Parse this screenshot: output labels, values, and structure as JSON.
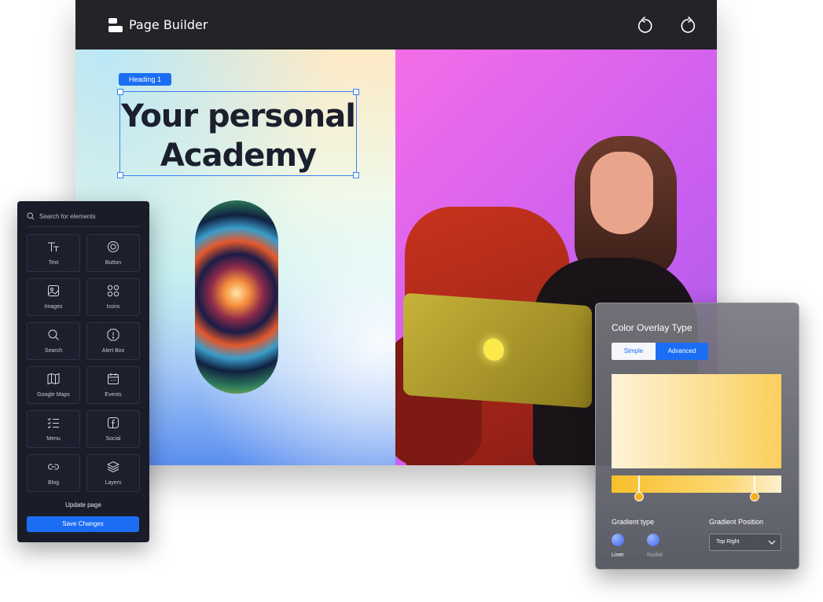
{
  "app": {
    "title": "Page Builder"
  },
  "toolbar": {
    "undo_icon": "undo-icon",
    "redo_icon": "redo-icon"
  },
  "canvas": {
    "heading_tag": "Heading 1",
    "heading_line1": "Your personal",
    "heading_line2": "Academy"
  },
  "elements_panel": {
    "search_placeholder": "Search for elements",
    "items": [
      {
        "label": "Text",
        "icon": "text-icon"
      },
      {
        "label": "Button",
        "icon": "button-icon"
      },
      {
        "label": "Images",
        "icon": "image-icon"
      },
      {
        "label": "Icons",
        "icon": "icons-grid-icon"
      },
      {
        "label": "Search",
        "icon": "search-icon"
      },
      {
        "label": "Alert Box",
        "icon": "alert-icon"
      },
      {
        "label": "Google Maps",
        "icon": "map-icon"
      },
      {
        "label": "Events",
        "icon": "calendar-icon"
      },
      {
        "label": "Menu",
        "icon": "menu-list-icon"
      },
      {
        "label": "Social",
        "icon": "facebook-icon"
      },
      {
        "label": "Blog",
        "icon": "link-icon"
      },
      {
        "label": "Layers",
        "icon": "layers-icon"
      }
    ],
    "update_label": "Update page",
    "save_label": "Save Changes"
  },
  "overlay_panel": {
    "title": "Color Overlay Type",
    "tabs": [
      {
        "label": "Simple",
        "active": false
      },
      {
        "label": "Advanced",
        "active": true
      }
    ],
    "gradient_colors": [
      "#fdf3d7",
      "#fbcf5c"
    ],
    "gradient_type_label": "Gradient type",
    "gradient_types": [
      {
        "label": "Liner",
        "selected": true
      },
      {
        "label": "Radial",
        "selected": false
      }
    ],
    "gradient_position_label": "Gradient Position",
    "gradient_position_value": "Top Right"
  },
  "colors": {
    "accent": "#1b6ef3",
    "panel_dark": "#1a1d29",
    "topbar": "#232427"
  }
}
